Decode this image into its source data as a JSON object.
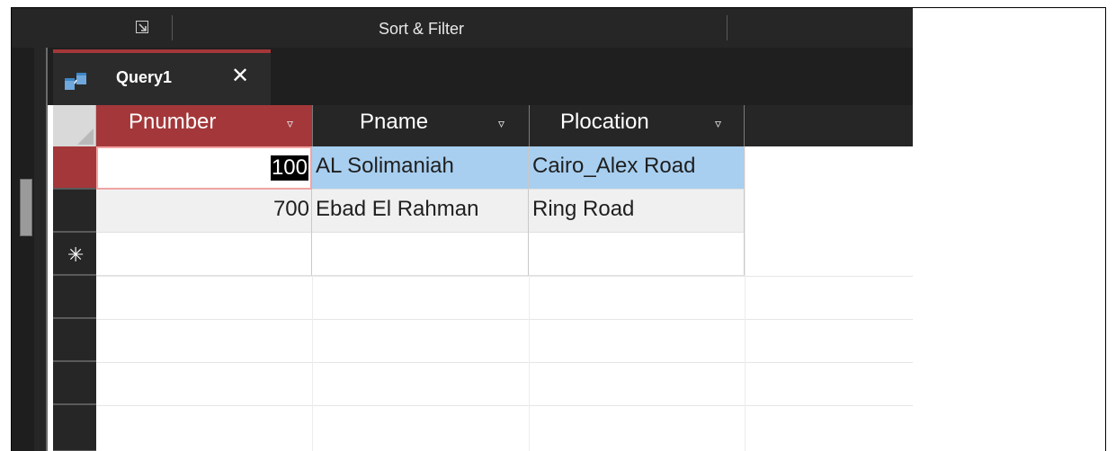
{
  "ribbon": {
    "group_label": "Sort & Filter",
    "launcher_icon": "dialog-launcher-icon"
  },
  "tab": {
    "title": "Query1",
    "close_glyph": "✕",
    "accent": "#a4373a",
    "icon": "query-icon"
  },
  "table": {
    "headers": [
      {
        "label": "Pnumber"
      },
      {
        "label": "Pname"
      },
      {
        "label": "Plocation"
      }
    ],
    "dropdown_glyph": "▿",
    "rows": [
      {
        "pnumber": "100",
        "pname": "AL Solimaniah",
        "plocation": "Cairo_Alex Road"
      },
      {
        "pnumber": "700",
        "pname": "Ebad El Rahman",
        "plocation": "Ring Road"
      }
    ],
    "new_row_glyph": "✳"
  }
}
